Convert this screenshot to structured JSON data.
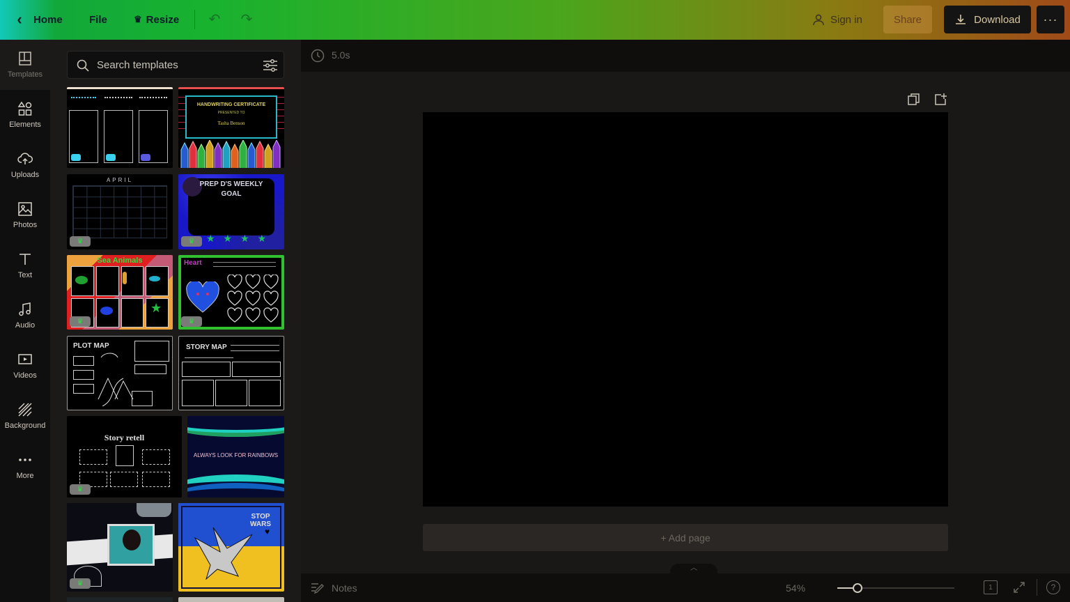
{
  "topbar": {
    "home_label": "Home",
    "file_label": "File",
    "resize_label": "Resize",
    "signin_label": "Sign in",
    "share_label": "Share",
    "download_label": "Download",
    "more_label": "···"
  },
  "rail": {
    "items": [
      {
        "label": "Templates",
        "icon": "templates-icon"
      },
      {
        "label": "Elements",
        "icon": "elements-icon"
      },
      {
        "label": "Uploads",
        "icon": "upload-cloud-icon"
      },
      {
        "label": "Photos",
        "icon": "photo-icon"
      },
      {
        "label": "Text",
        "icon": "text-t-icon"
      },
      {
        "label": "Audio",
        "icon": "music-note-icon"
      },
      {
        "label": "Videos",
        "icon": "video-icon"
      },
      {
        "label": "Background",
        "icon": "background-stripes-icon"
      },
      {
        "label": "More",
        "icon": "more-dots-icon"
      }
    ]
  },
  "search": {
    "placeholder": "Search templates"
  },
  "templates": {
    "april_title": "APRIL",
    "handwriting_title": "HANDWRITING CERTIFICATE",
    "handwriting_sub": "PRESENTED TO",
    "handwriting_name": "Tasha Benson",
    "weekly_goal_title": "PREP D'S WEEKLY GOAL",
    "sea_animals_title": "Sea Animals",
    "heart_title": "Heart",
    "plot_map_title": "PLOT MAP",
    "story_map_title": "STORY MAP",
    "story_retell_title": "Story retell",
    "rainbows_title": "ALWAYS LOOK FOR RAINBOWS",
    "stop_wars_title": "STOP WARS",
    "badge": "♛"
  },
  "canvas": {
    "timer": "5.0s",
    "add_page": "+ Add page"
  },
  "bottombar": {
    "notes_label": "Notes",
    "zoom_pct": "54%",
    "zoom_level": 0.54,
    "page_count": "1",
    "help": "?"
  }
}
